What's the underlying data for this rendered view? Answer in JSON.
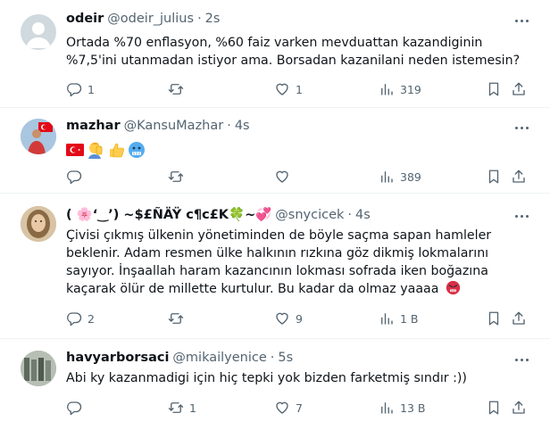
{
  "tweets": [
    {
      "name": "odeir",
      "handle": "@odeir_julius",
      "sep": "·",
      "time": "2s",
      "text": "Ortada %70 enflasyon, %60 faiz varken mevduattan kazandiginin %7,5'ini utanmadan istiyor ama. Borsadan kazanilani neden istemesin?",
      "replies": "1",
      "retweets": "",
      "likes": "1",
      "views": "319"
    },
    {
      "name": "mazhar",
      "handle": "@KansuMazhar",
      "sep": "·",
      "time": "4s",
      "text": "",
      "emojis": [
        "turkey-flag",
        "person-facepalm",
        "thumbs-up",
        "cold-face"
      ],
      "replies": "",
      "retweets": "",
      "likes": "",
      "views": "389"
    },
    {
      "name": "( 🌸‘‿’) ~$£ÑÄŸ c¶c£K🍀~💞",
      "handle": "@snycicek",
      "sep": "·",
      "time": "4s",
      "text": "Çivisi çıkmış ülkenin yönetiminden de böyle saçma sapan hamleler beklenir. Adam resmen ülke halkının rızkına göz dikmiş lokmalarını sayıyor. İnşaallah haram kazancının lokması sofrada iken boğazına kaçarak ölür de millette kurtulur. Bu kadar da olmaz yaaaa",
      "trailing_emoji": "angry-face",
      "replies": "2",
      "retweets": "",
      "likes": "9",
      "views": "1 B"
    },
    {
      "name": "havyarborsaci",
      "handle": "@mikailyenice",
      "sep": "·",
      "time": "5s",
      "text": "Abi ky kazanmadigi için hiç tepki yok bizden farketmiş sındır :))",
      "replies": "",
      "retweets": "1",
      "likes": "7",
      "views": "13 B"
    }
  ],
  "colors": {
    "text": "#0f1419",
    "secondary": "#536471",
    "border": "#eff3f4"
  }
}
